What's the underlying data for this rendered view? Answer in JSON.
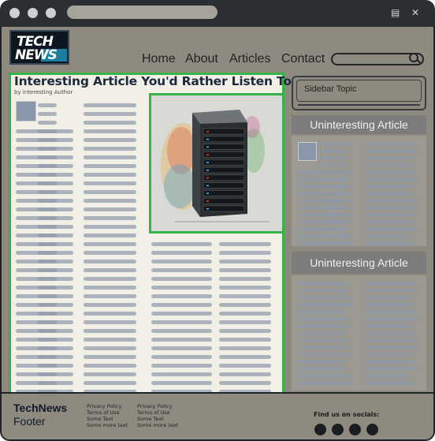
{
  "browser": {
    "url_text": "",
    "window_controls": [
      "menu-icon",
      "close-icon"
    ]
  },
  "header": {
    "logo_line1": "TECH",
    "logo_line2": "NEWS",
    "nav": [
      "Home",
      "About",
      "Articles",
      "Contact"
    ],
    "search_placeholder": ""
  },
  "article": {
    "title": "Interesting Article You'd Rather Listen To",
    "byline": "by interesting Author",
    "image_alt": "server-rack-image"
  },
  "sidebar": {
    "topic": "Sidebar Topic",
    "sections": [
      {
        "title": "Uninteresting Article"
      },
      {
        "title": "Uninteresting Article"
      }
    ]
  },
  "footer": {
    "brand_line1": "TechNews",
    "brand_line2": "Footer",
    "col1": [
      "Privacy Policy",
      "Terms of Use",
      "Some Text",
      "Some more text"
    ],
    "col2": [
      "Privacy Policy",
      "Terms of Use",
      "Some Text",
      "Some more text"
    ],
    "socials_label": "Find us on socials:",
    "social_icons": [
      "social-icon-1",
      "social-icon-2",
      "social-icon-3",
      "social-icon-4"
    ]
  },
  "colors": {
    "accent_border": "#36b347",
    "page_bg": "#8f8a7f",
    "article_bg": "#f1efe6"
  }
}
